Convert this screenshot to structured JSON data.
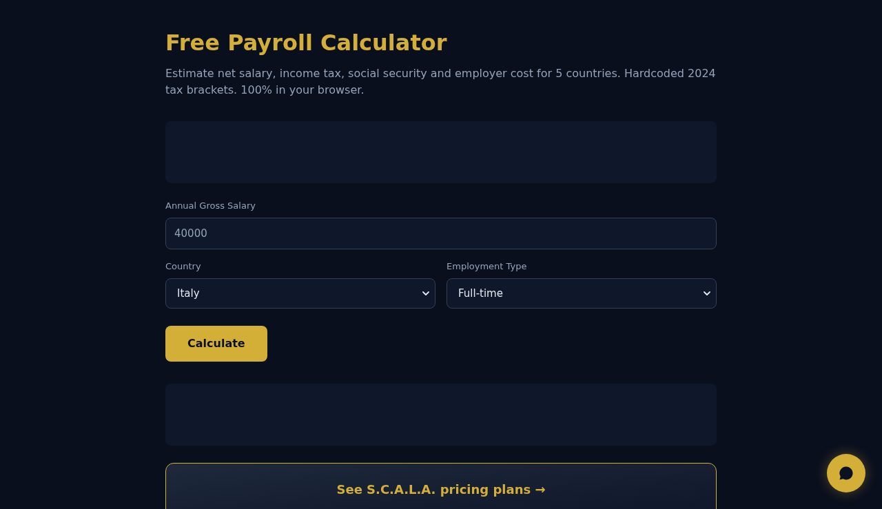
{
  "header": {
    "title": "Free Payroll Calculator",
    "subtitle": "Estimate net salary, income tax, social security and employer cost for 5 countries. Hardcoded 2024 tax brackets. 100% in your browser."
  },
  "form": {
    "salary": {
      "label": "Annual Gross Salary",
      "placeholder": "40000"
    },
    "country": {
      "label": "Country",
      "value": "Italy"
    },
    "employment_type": {
      "label": "Employment Type",
      "value": "Full-time"
    },
    "calculate_button": "Calculate"
  },
  "pricing_link": "See S.C.A.L.A. pricing plans →"
}
